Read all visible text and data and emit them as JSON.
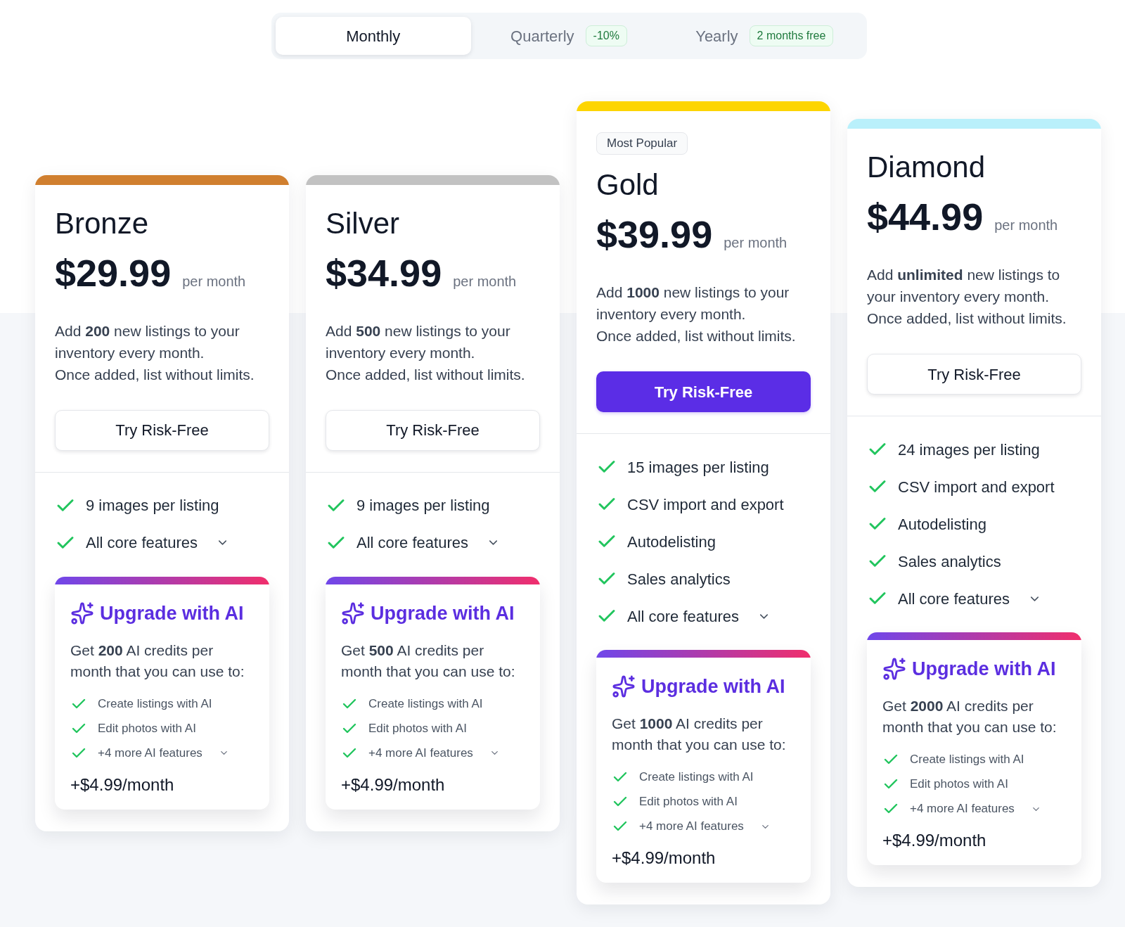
{
  "billing_tabs": [
    {
      "label": "Monthly",
      "selected": true
    },
    {
      "label": "Quarterly",
      "badge": "-10%",
      "selected": false
    },
    {
      "label": "Yearly",
      "badge": "2 months free",
      "selected": false
    }
  ],
  "plans": [
    {
      "name": "Bronze",
      "color": "#d07f2f",
      "price": "$29.99",
      "period": "per month",
      "description": [
        "Add **200** new listings to your inventory every month.",
        "Once added, list without limits."
      ],
      "button": {
        "label": "Try Risk-Free",
        "primary": false
      },
      "features": [
        {
          "kind": "item",
          "label": "9 images per listing"
        },
        {
          "kind": "expander",
          "label": "All core features"
        }
      ],
      "ai_upgrade": {
        "title": "Upgrade with AI",
        "description": "Get **200** AI credits per month that you can use to:",
        "features": [
          {
            "kind": "item",
            "label": "Create listings with AI"
          },
          {
            "kind": "item",
            "label": "Edit photos with AI"
          },
          {
            "kind": "expander",
            "label": "+4 more AI features"
          }
        ],
        "price": "+$4.99/month"
      }
    },
    {
      "name": "Silver",
      "color": "#c2c2c2",
      "price": "$34.99",
      "period": "per month",
      "description": [
        "Add **500** new listings to your inventory every month.",
        "Once added, list without limits."
      ],
      "button": {
        "label": "Try Risk-Free",
        "primary": false
      },
      "features": [
        {
          "kind": "item",
          "label": "9 images per listing"
        },
        {
          "kind": "expander",
          "label": "All core features"
        }
      ],
      "ai_upgrade": {
        "title": "Upgrade with AI",
        "description": "Get **500** AI credits per month that you can use to:",
        "features": [
          {
            "kind": "item",
            "label": "Create listings with AI"
          },
          {
            "kind": "item",
            "label": "Edit photos with AI"
          },
          {
            "kind": "expander",
            "label": "+4 more AI features"
          }
        ],
        "price": "+$4.99/month"
      }
    },
    {
      "name": "Gold",
      "badge": "Most Popular",
      "color": "#fdd500",
      "price": "$39.99",
      "period": "per month",
      "description": [
        "Add **1000** new listings to your inventory every month.",
        "Once added, list without limits."
      ],
      "button": {
        "label": "Try Risk-Free",
        "primary": true
      },
      "features": [
        {
          "kind": "item",
          "label": "15 images per listing"
        },
        {
          "kind": "item",
          "label": "CSV import and export"
        },
        {
          "kind": "item",
          "label": "Autodelisting"
        },
        {
          "kind": "item",
          "label": "Sales analytics"
        },
        {
          "kind": "expander",
          "label": "All core features"
        }
      ],
      "ai_upgrade": {
        "title": "Upgrade with AI",
        "description": "Get **1000** AI credits per month that you can use to:",
        "features": [
          {
            "kind": "item",
            "label": "Create listings with AI"
          },
          {
            "kind": "item",
            "label": "Edit photos with AI"
          },
          {
            "kind": "expander",
            "label": "+4 more AI features"
          }
        ],
        "price": "+$4.99/month"
      }
    },
    {
      "name": "Diamond",
      "color": "#b9f0fb",
      "price": "$44.99",
      "period": "per month",
      "description": [
        "Add **unlimited** new listings to your inventory every month.",
        "Once added, list without limits."
      ],
      "button": {
        "label": "Try Risk-Free",
        "primary": false
      },
      "features": [
        {
          "kind": "item",
          "label": "24 images per listing"
        },
        {
          "kind": "item",
          "label": "CSV import and export"
        },
        {
          "kind": "item",
          "label": "Autodelisting"
        },
        {
          "kind": "item",
          "label": "Sales analytics"
        },
        {
          "kind": "expander",
          "label": "All core features"
        }
      ],
      "ai_upgrade": {
        "title": "Upgrade with AI",
        "description": "Get **2000** AI credits per month that you can use to:",
        "features": [
          {
            "kind": "item",
            "label": "Create listings with AI"
          },
          {
            "kind": "item",
            "label": "Edit photos with AI"
          },
          {
            "kind": "expander",
            "label": "+4 more AI features"
          }
        ],
        "price": "+$4.99/month"
      }
    }
  ]
}
